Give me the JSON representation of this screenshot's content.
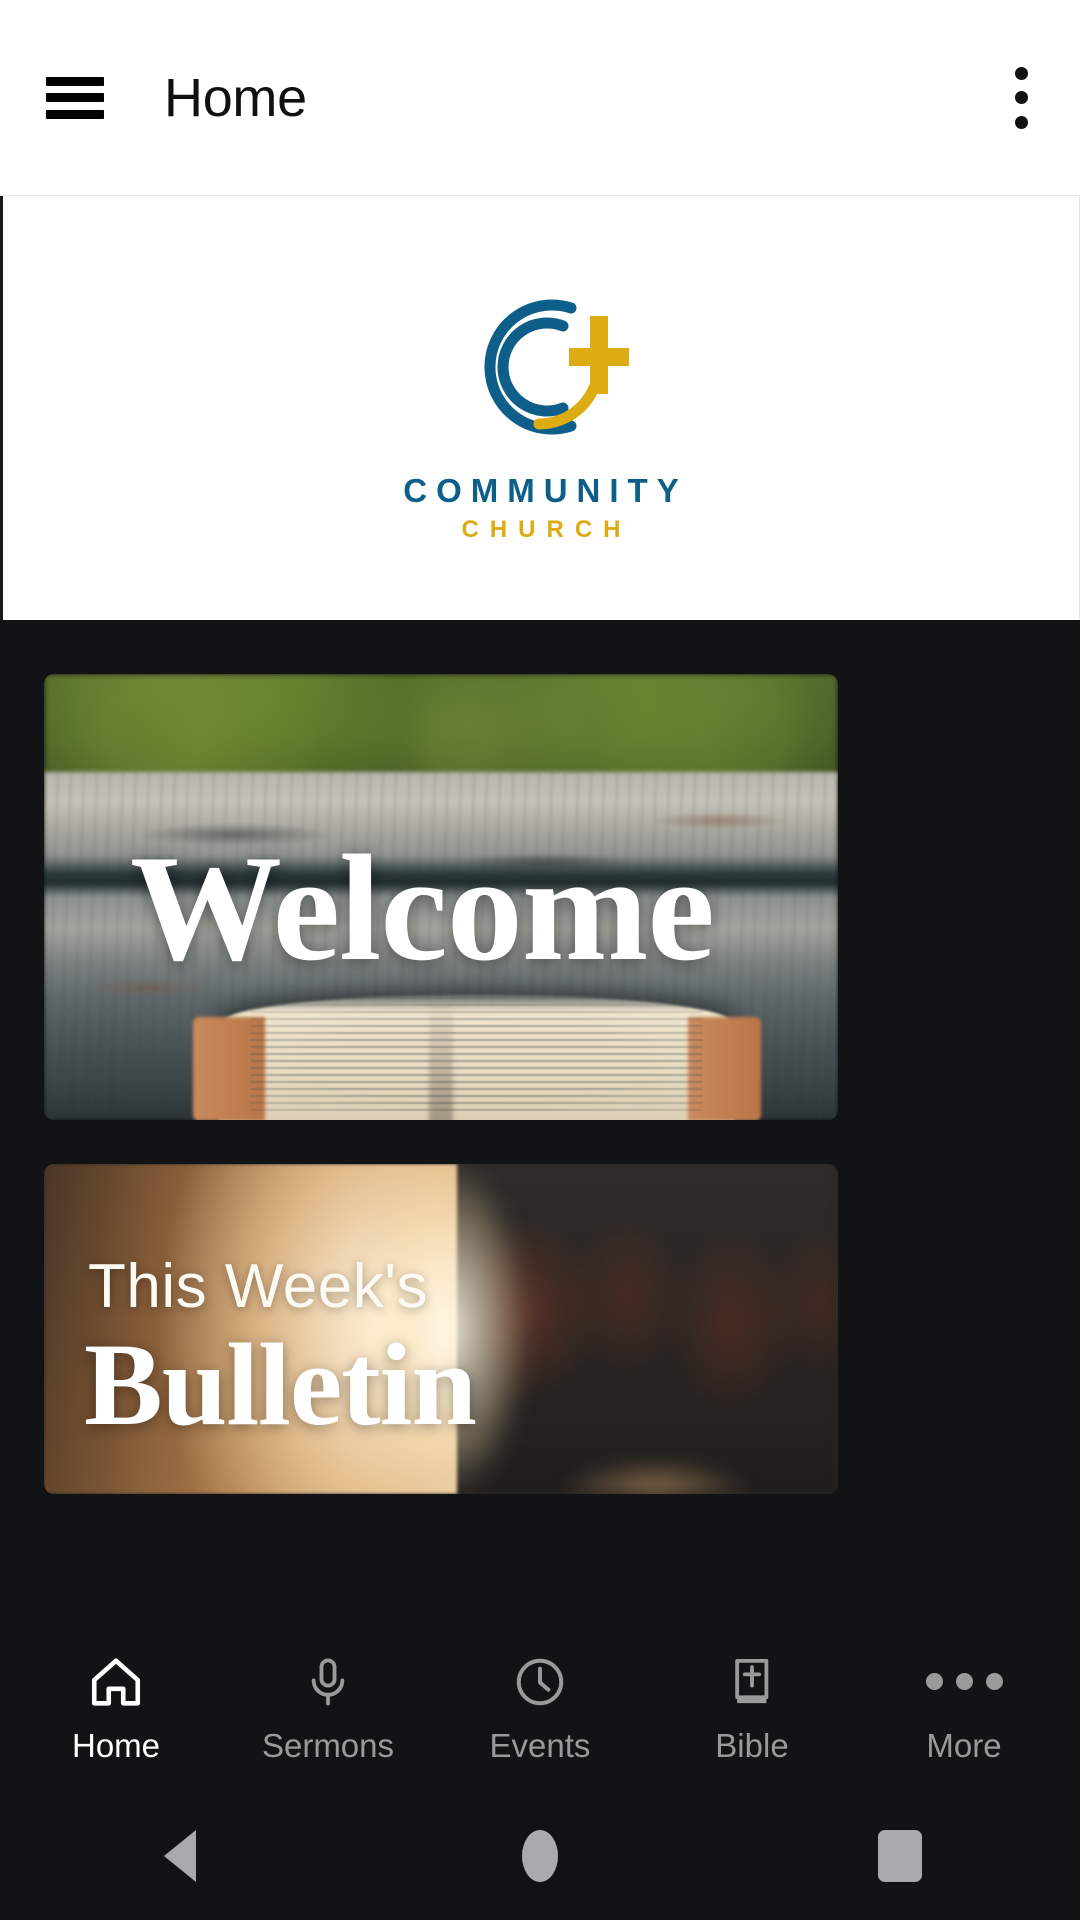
{
  "appbar": {
    "menu_icon": "hamburger-menu-icon",
    "title": "Home",
    "overflow_icon": "kebab-menu-icon"
  },
  "logo": {
    "mark_icon": "community-church-logo-icon",
    "word": "COMMUNITY",
    "sub": "CHURCH",
    "colors": {
      "blue": "#0d5f8a",
      "gold": "#ddab12"
    }
  },
  "cards": [
    {
      "id": "welcome",
      "title": "Welcome",
      "image_description": "open-bible-on-weathered-wood-bench"
    },
    {
      "id": "bulletin",
      "kicker": "This Week's",
      "title": "Bulletin",
      "image_description": "warm-lit-church-interior"
    }
  ],
  "tabbar": {
    "active": "Home",
    "items": [
      {
        "label": "Home",
        "icon": "house-icon",
        "active": true
      },
      {
        "label": "Sermons",
        "icon": "microphone-icon",
        "active": false
      },
      {
        "label": "Events",
        "icon": "clock-icon",
        "active": false
      },
      {
        "label": "Bible",
        "icon": "bible-book-cross-icon",
        "active": false
      },
      {
        "label": "More",
        "icon": "ellipsis-icon",
        "active": false
      }
    ],
    "colors": {
      "active": "#ffffff",
      "inactive": "#9a9a9a",
      "background": "#121314"
    }
  },
  "system_nav": {
    "back_icon": "triangle-back-icon",
    "home_icon": "circle-home-icon",
    "recents_icon": "square-recents-icon"
  }
}
